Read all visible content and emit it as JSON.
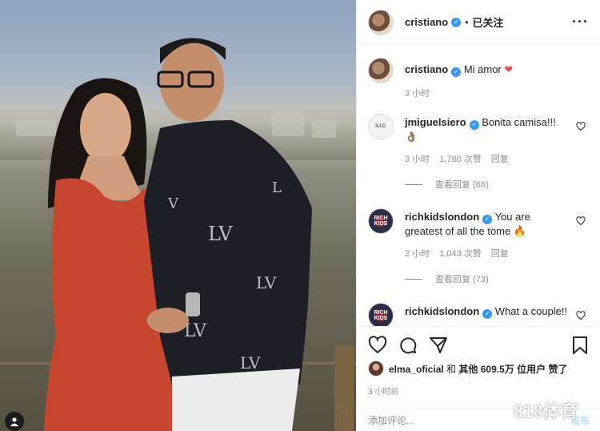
{
  "header": {
    "username": "cristiano",
    "dot": "•",
    "follow_status": "已关注",
    "more_icon": "···"
  },
  "caption": {
    "username": "cristiano",
    "text": "Mi amor",
    "emoji": "❤",
    "time": "3 小时"
  },
  "comments": [
    {
      "username": "jmiguelsiero",
      "avatar_text": "S.I.C.",
      "text": "Bonita camisa!!!👌🏽",
      "time": "3 小时",
      "likes": "1,780 次赞",
      "reply": "回复",
      "view_replies": "查看回复 (66)"
    },
    {
      "username": "richkidslondon",
      "avatar_text": "RICH KIDS",
      "text": "You are greatest of all the tome 🔥",
      "time": "2 小时",
      "likes": "1,043 次赞",
      "reply": "回复",
      "view_replies": "查看回复 (73)"
    },
    {
      "username": "richkidslondon",
      "avatar_text": "RICH KIDS",
      "text": "What a couple!!"
    }
  ],
  "likes_line": {
    "username": "elma_oficial",
    "connector": "和",
    "others_bold": "其他 609.5万 位用户",
    "suffix": "赞了"
  },
  "post_time": "3 小时前",
  "add_comment": {
    "placeholder": "添加评论...",
    "post_label": "发布"
  },
  "watermark": "818体育",
  "colors": {
    "verified": "#3897f0",
    "heart": "#ed4956",
    "muted": "#8e8e8e",
    "post_disabled": "#b2dffc"
  }
}
